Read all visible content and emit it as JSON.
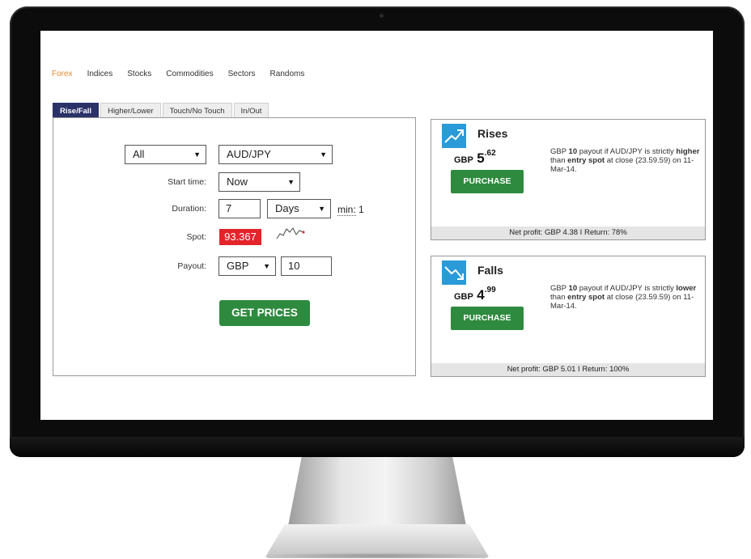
{
  "nav": {
    "items": [
      {
        "label": "Forex",
        "active": true
      },
      {
        "label": "Indices",
        "active": false
      },
      {
        "label": "Stocks",
        "active": false
      },
      {
        "label": "Commodities",
        "active": false
      },
      {
        "label": "Sectors",
        "active": false
      },
      {
        "label": "Randoms",
        "active": false
      }
    ]
  },
  "tabs": [
    {
      "label": "Rise/Fall",
      "active": true
    },
    {
      "label": "Higher/Lower",
      "active": false
    },
    {
      "label": "Touch/No Touch",
      "active": false
    },
    {
      "label": "In/Out",
      "active": false
    }
  ],
  "form": {
    "market_select": "All",
    "symbol_select": "AUD/JPY",
    "start_time_label": "Start time:",
    "start_time_value": "Now",
    "duration_label": "Duration:",
    "duration_value": "7",
    "duration_unit": "Days",
    "min_label": "min:",
    "min_value": "1",
    "spot_label": "Spot:",
    "spot_value": "93.367",
    "payout_label": "Payout:",
    "payout_currency": "GBP",
    "payout_amount": "10",
    "get_prices_label": "GET PRICES"
  },
  "contracts": [
    {
      "title": "Rises",
      "currency": "GBP",
      "price_int": "5",
      "price_dec": ".62",
      "purchase_label": "PURCHASE",
      "desc_pre": "GBP ",
      "desc_amount": "10",
      "desc_mid1": " payout if AUD/JPY is strictly ",
      "desc_dir": "higher",
      "desc_mid2": " than ",
      "desc_spot": "entry spot",
      "desc_post": " at close (23.59.59) on 11-Mar-14.",
      "footer": "Net profit: GBP 4.38 I Return: 78%",
      "icon": "trend-up-icon"
    },
    {
      "title": "Falls",
      "currency": "GBP",
      "price_int": "4",
      "price_dec": ".99",
      "purchase_label": "PURCHASE",
      "desc_pre": "GBP ",
      "desc_amount": "10",
      "desc_mid1": " payout if AUD/JPY is strictly ",
      "desc_dir": "lower",
      "desc_mid2": " than ",
      "desc_spot": "entry spot",
      "desc_post": " at close (23.59.59) on 11-Mar-14.",
      "footer": "Net profit: GBP 5.01 I Return: 100%",
      "icon": "trend-down-icon"
    }
  ],
  "colors": {
    "active_nav": "#e88a2e",
    "active_tab": "#2a3268",
    "button_green": "#2e8a3e",
    "spot_red": "#e3242b",
    "icon_blue": "#2a9ad8"
  }
}
